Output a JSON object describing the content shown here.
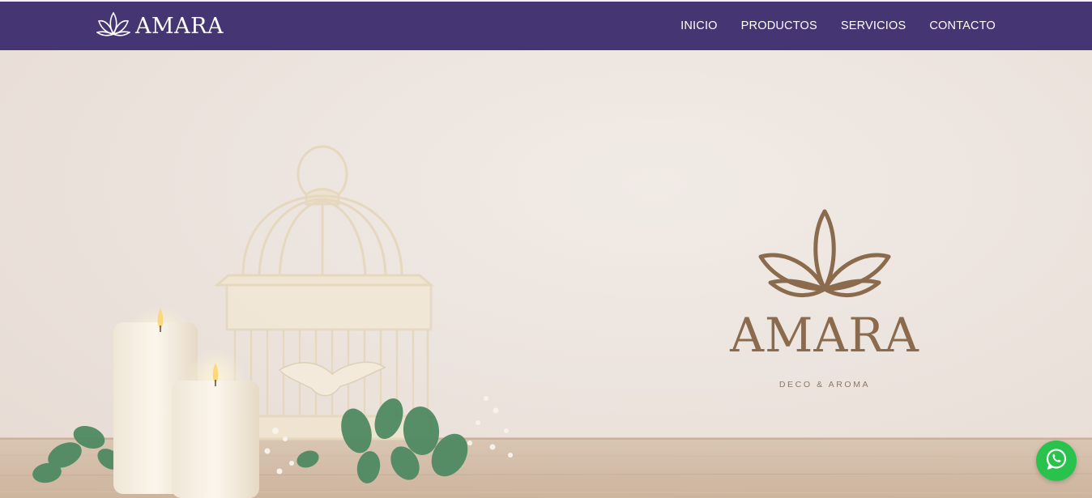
{
  "header": {
    "logo_text": "AMARA",
    "logo_icon": "lotus-icon",
    "nav": [
      {
        "label": "INICIO"
      },
      {
        "label": "PRODUCTOS"
      },
      {
        "label": "SERVICIOS"
      },
      {
        "label": "CONTACTO"
      }
    ]
  },
  "hero": {
    "image": "candles-birdcage-eucalyptus-photo",
    "brand_name": "AMARA",
    "brand_tagline": "DECO & AROMA",
    "brand_icon": "lotus-icon"
  },
  "floating": {
    "whatsapp_icon": "whatsapp-icon"
  },
  "colors": {
    "navbar": "#453573",
    "brand": "#8a6b4d",
    "whatsapp": "#29c24d"
  }
}
